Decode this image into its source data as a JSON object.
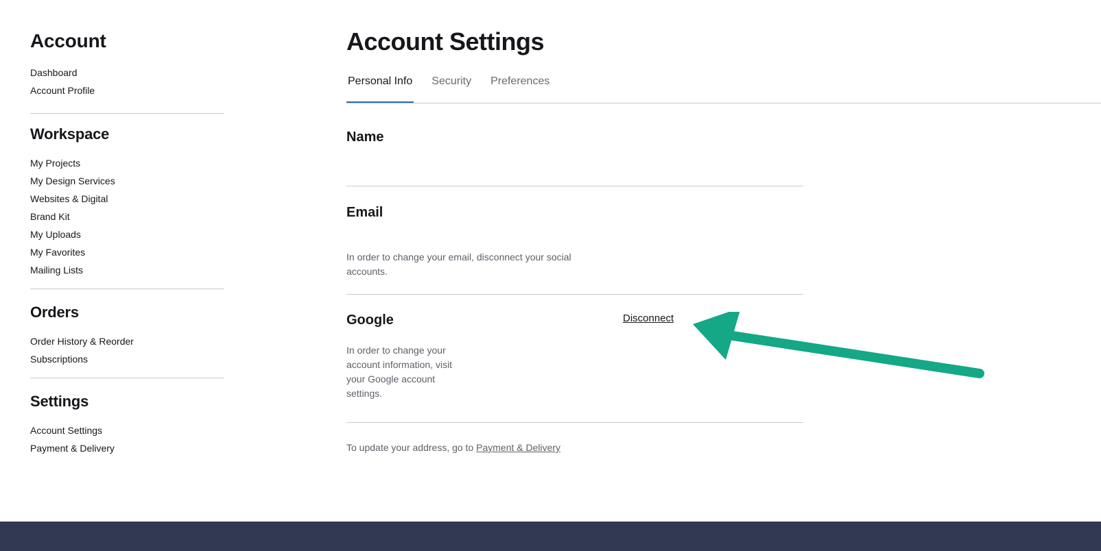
{
  "sidebar": {
    "groups": [
      {
        "heading": "Account",
        "items": [
          "Dashboard",
          "Account Profile"
        ]
      },
      {
        "heading": "Workspace",
        "items": [
          "My Projects",
          "My Design Services",
          "Websites & Digital",
          "Brand Kit",
          "My Uploads",
          "My Favorites",
          "Mailing Lists"
        ]
      },
      {
        "heading": "Orders",
        "items": [
          "Order History & Reorder",
          "Subscriptions"
        ]
      },
      {
        "heading": "Settings",
        "items": [
          "Account Settings",
          "Payment & Delivery"
        ]
      }
    ]
  },
  "main": {
    "title": "Account Settings",
    "tabs": [
      {
        "label": "Personal Info",
        "active": true
      },
      {
        "label": "Security",
        "active": false
      },
      {
        "label": "Preferences",
        "active": false
      }
    ],
    "sections": {
      "name": {
        "title": "Name"
      },
      "email": {
        "title": "Email",
        "help": "In order to change your email, disconnect your social accounts."
      },
      "google": {
        "title": "Google",
        "help": "In order to change your account information, visit your Google account settings.",
        "action": "Disconnect"
      }
    },
    "address_note": {
      "text": "To update your address, go to ",
      "link": "Payment & Delivery"
    }
  },
  "annotation": {
    "icon": "arrow-icon",
    "color": "#14a886"
  },
  "colors": {
    "accent": "#2a6ebb",
    "footer": "#313a52"
  }
}
